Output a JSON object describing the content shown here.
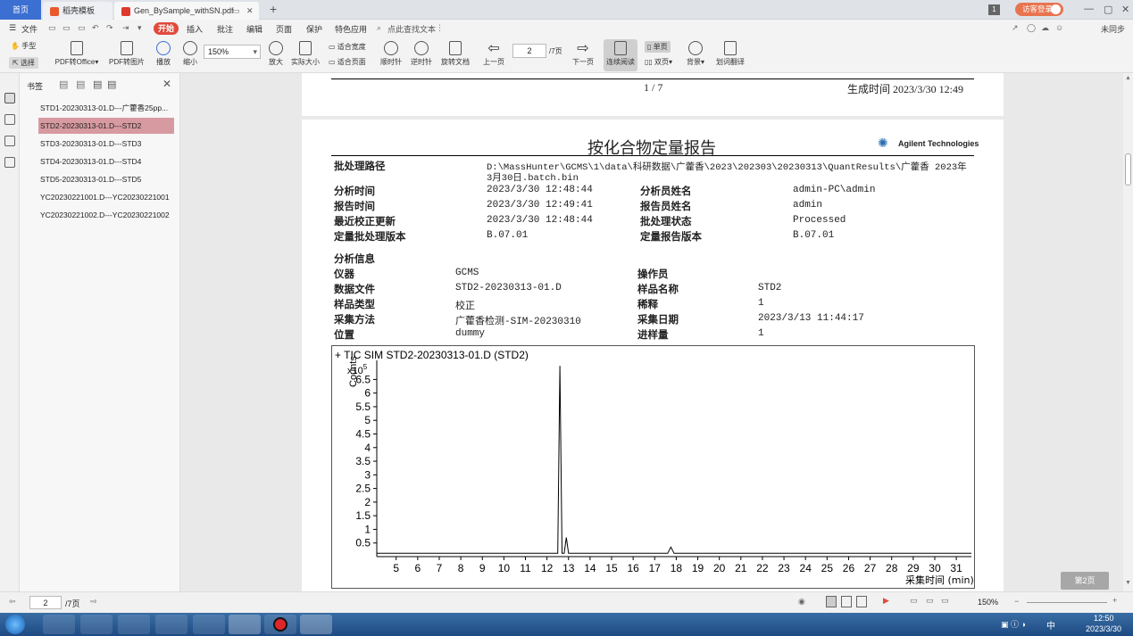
{
  "titlebar": {
    "tabs": [
      {
        "label": "首页"
      },
      {
        "label": "稻壳模板"
      },
      {
        "label": "Gen_BySample_withSN.pdf"
      }
    ],
    "badge": "1",
    "login_button": "访客登录"
  },
  "menubar": {
    "file": "文件",
    "items": [
      "开始",
      "插入",
      "批注",
      "编辑",
      "页面",
      "保护",
      "特色应用"
    ],
    "search_placeholder": "点此查找文本",
    "sync": "未同步"
  },
  "toolbar": {
    "hand": "手型",
    "select": "选择",
    "pdf_to_office": "PDF转Office",
    "pdf_to_image": "PDF转图片",
    "play": "播放",
    "zoom_out": "缩小",
    "zoom_value": "150%",
    "zoom_in": "放大",
    "actual_size": "实际大小",
    "fit_width": "适合宽度",
    "fit_page": "适合页面",
    "rotate_cw": "顺时针",
    "rotate_ccw": "逆时针",
    "rotate_doc": "旋转文档",
    "prev_page": "上一页",
    "page_input": "2",
    "page_total": "/7页",
    "next_page": "下一页",
    "continuous": "连续阅读",
    "single": "单页",
    "double": "双页",
    "background": "背景",
    "translate": "划词翻译"
  },
  "sidebar": {
    "title": "书签",
    "items": [
      {
        "label": "STD1-20230313-01.D---广藿香25pp..."
      },
      {
        "label": "STD2-20230313-01.D---STD2"
      },
      {
        "label": "STD3-20230313-01.D---STD3"
      },
      {
        "label": "STD4-20230313-01.D---STD4"
      },
      {
        "label": "STD5-20230313-01.D---STD5"
      },
      {
        "label": "YC20230221001.D---YC20230221001"
      },
      {
        "label": "YC20230221002.D---YC20230221002"
      }
    ]
  },
  "page1": {
    "page_counter": "1 / 7",
    "generated": "生成时间 2023/3/30 12:49"
  },
  "report": {
    "title": "按化合物定量报告",
    "brand": "Agilent Technologies",
    "batch_path_label": "批处理路径",
    "batch_path_line1": "D:\\MassHunter\\GCMS\\1\\data\\科研数据\\广藿香\\2023\\202303\\20230313\\QuantResults\\广藿香 2023年",
    "batch_path_line2": "3月30日.batch.bin",
    "rows": [
      {
        "l1": "分析时间",
        "v1": "2023/3/30 12:48:44",
        "l2": "分析员姓名",
        "v2": "admin-PC\\admin"
      },
      {
        "l1": "报告时间",
        "v1": "2023/3/30 12:49:41",
        "l2": "报告员姓名",
        "v2": "admin"
      },
      {
        "l1": "最近校正更新",
        "v1": "2023/3/30 12:48:44",
        "l2": "批处理状态",
        "v2": "Processed"
      },
      {
        "l1": "定量批处理版本",
        "v1": "B.07.01",
        "l2": "定量报告版本",
        "v2": "B.07.01"
      }
    ],
    "analysis_info": "分析信息",
    "info_rows": [
      {
        "l1": "仪器",
        "v1": "GCMS",
        "l2": "操作员",
        "v2": ""
      },
      {
        "l1": "数据文件",
        "v1": "STD2-20230313-01.D",
        "l2": "样品名称",
        "v2": "STD2"
      },
      {
        "l1": "样品类型",
        "v1": "校正",
        "l2": "稀释",
        "v2": "1"
      },
      {
        "l1": "采集方法",
        "v1": "广藿香检测-SIM-20230310",
        "l2": "采集日期",
        "v2": "2023/3/13 11:44:17"
      },
      {
        "l1": "位置",
        "v1": "dummy",
        "l2": "进样量",
        "v2": "1"
      }
    ]
  },
  "chart_data": {
    "type": "line",
    "title": "+ TIC SIM STD2-20230313-01.D (STD2)",
    "ylabel": "Counts",
    "y_multiplier": "x10^5",
    "xlabel": "采集时间 (min)",
    "xlim": [
      4.1,
      31.7
    ],
    "ylim": [
      0,
      7.2
    ],
    "xticks": [
      5,
      6,
      7,
      8,
      9,
      10,
      11,
      12,
      13,
      14,
      15,
      16,
      17,
      18,
      19,
      20,
      21,
      22,
      23,
      24,
      25,
      26,
      27,
      28,
      29,
      30,
      31
    ],
    "yticks": [
      0.5,
      1,
      1.5,
      2,
      2.5,
      3,
      3.5,
      4,
      4.5,
      5,
      5.5,
      6,
      6.5
    ],
    "series": [
      {
        "x": [
          4.1,
          12.5,
          12.6,
          12.7,
          12.8,
          12.9,
          13.0,
          13.05,
          13.1,
          13.2,
          17.6,
          17.75,
          17.9,
          31.7
        ],
        "y": [
          0.12,
          0.12,
          7.0,
          0.12,
          0.12,
          0.7,
          0.12,
          0.12,
          0.12,
          0.12,
          0.12,
          0.35,
          0.12,
          0.12
        ]
      }
    ]
  },
  "status": {
    "page_input": "2",
    "page_total": "/7页",
    "zoom": "150%",
    "float_button": "第2页"
  },
  "taskbar": {
    "time": "12:50",
    "date": "2023/3/30",
    "ime": "中"
  }
}
